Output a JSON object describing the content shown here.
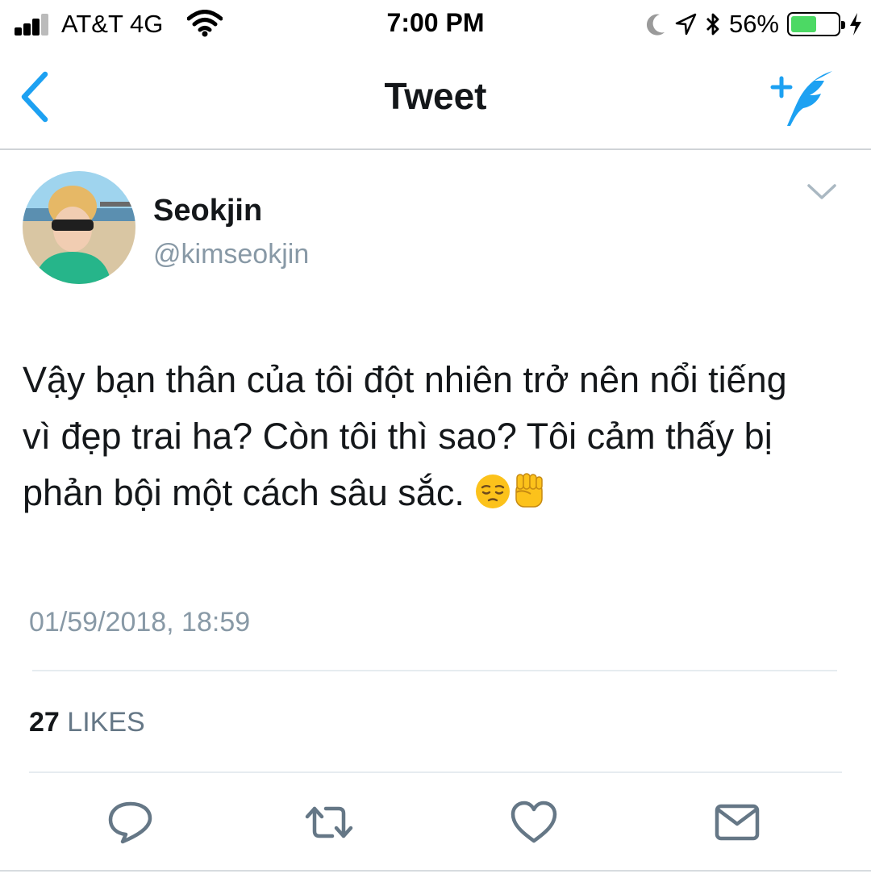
{
  "status_bar": {
    "carrier": "AT&T 4G",
    "time": "7:00 PM",
    "battery_percent": "56%",
    "battery_level": 0.56,
    "icons": [
      "signal-icon",
      "wifi-icon",
      "moon-icon",
      "location-icon",
      "bluetooth-icon",
      "battery-icon",
      "charging-icon"
    ]
  },
  "nav": {
    "title": "Tweet",
    "back_icon": "chevron-left-icon",
    "compose_icon": "compose-tweet-icon"
  },
  "tweet": {
    "display_name": "Seokjin",
    "handle": "@kimseokjin",
    "text_lines": [
      "Vậy bạn thân của tôi đột nhiên trở nên nổi tiếng",
      "vì đẹp trai ha? Còn tôi thì sao? Tôi cảm thấy bị",
      "phản bội một cách sâu sắc. "
    ],
    "emojis": [
      "pensive-face-emoji",
      "raised-fist-emoji"
    ],
    "timestamp": "01/59/2018, 18:59",
    "likes_count": "27",
    "likes_label": "LIKES"
  },
  "actions": [
    "reply-icon",
    "retweet-icon",
    "like-icon",
    "message-icon"
  ],
  "colors": {
    "accent": "#1da1f2",
    "secondary_text": "#8899a6",
    "action_icon": "#657786",
    "battery_fill": "#4cd964"
  }
}
